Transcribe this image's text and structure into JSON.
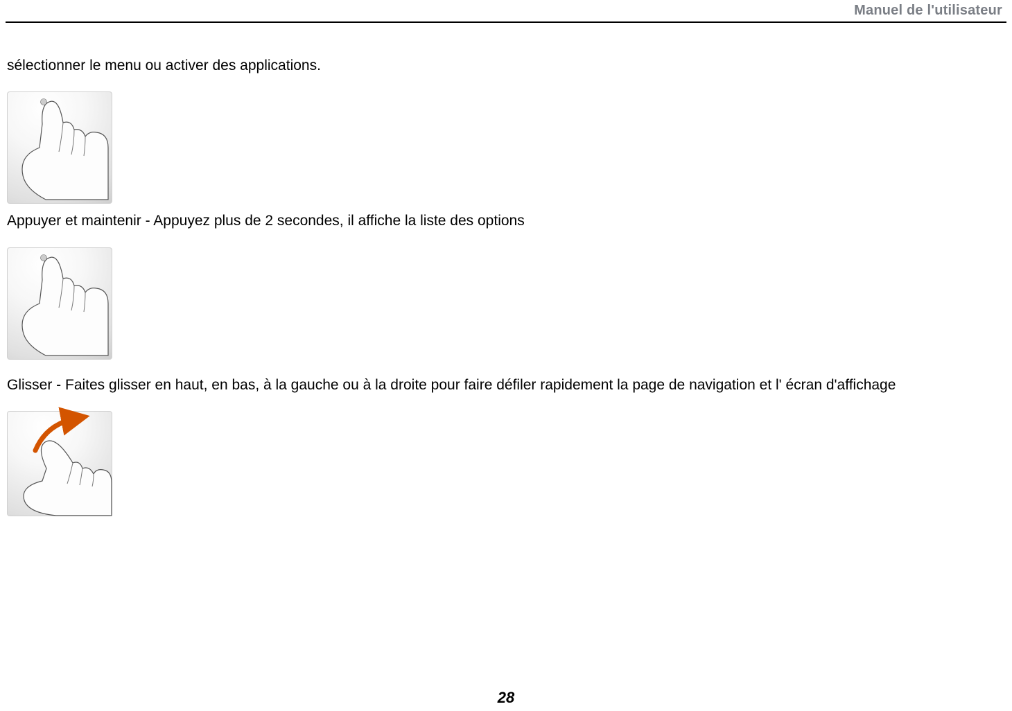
{
  "header": {
    "title": "Manuel de l'utilisateur"
  },
  "body": {
    "para1": "sélectionner le menu ou activer des applications.",
    "para2": "Appuyer et maintenir - Appuyez plus de 2 secondes, il affiche la liste des options",
    "para3": "Glisser - Faites glisser en haut, en bas, à la gauche ou à la droite pour faire défiler rapidement la page de navigation et l' écran d'affichage"
  },
  "pageNumber": "28"
}
